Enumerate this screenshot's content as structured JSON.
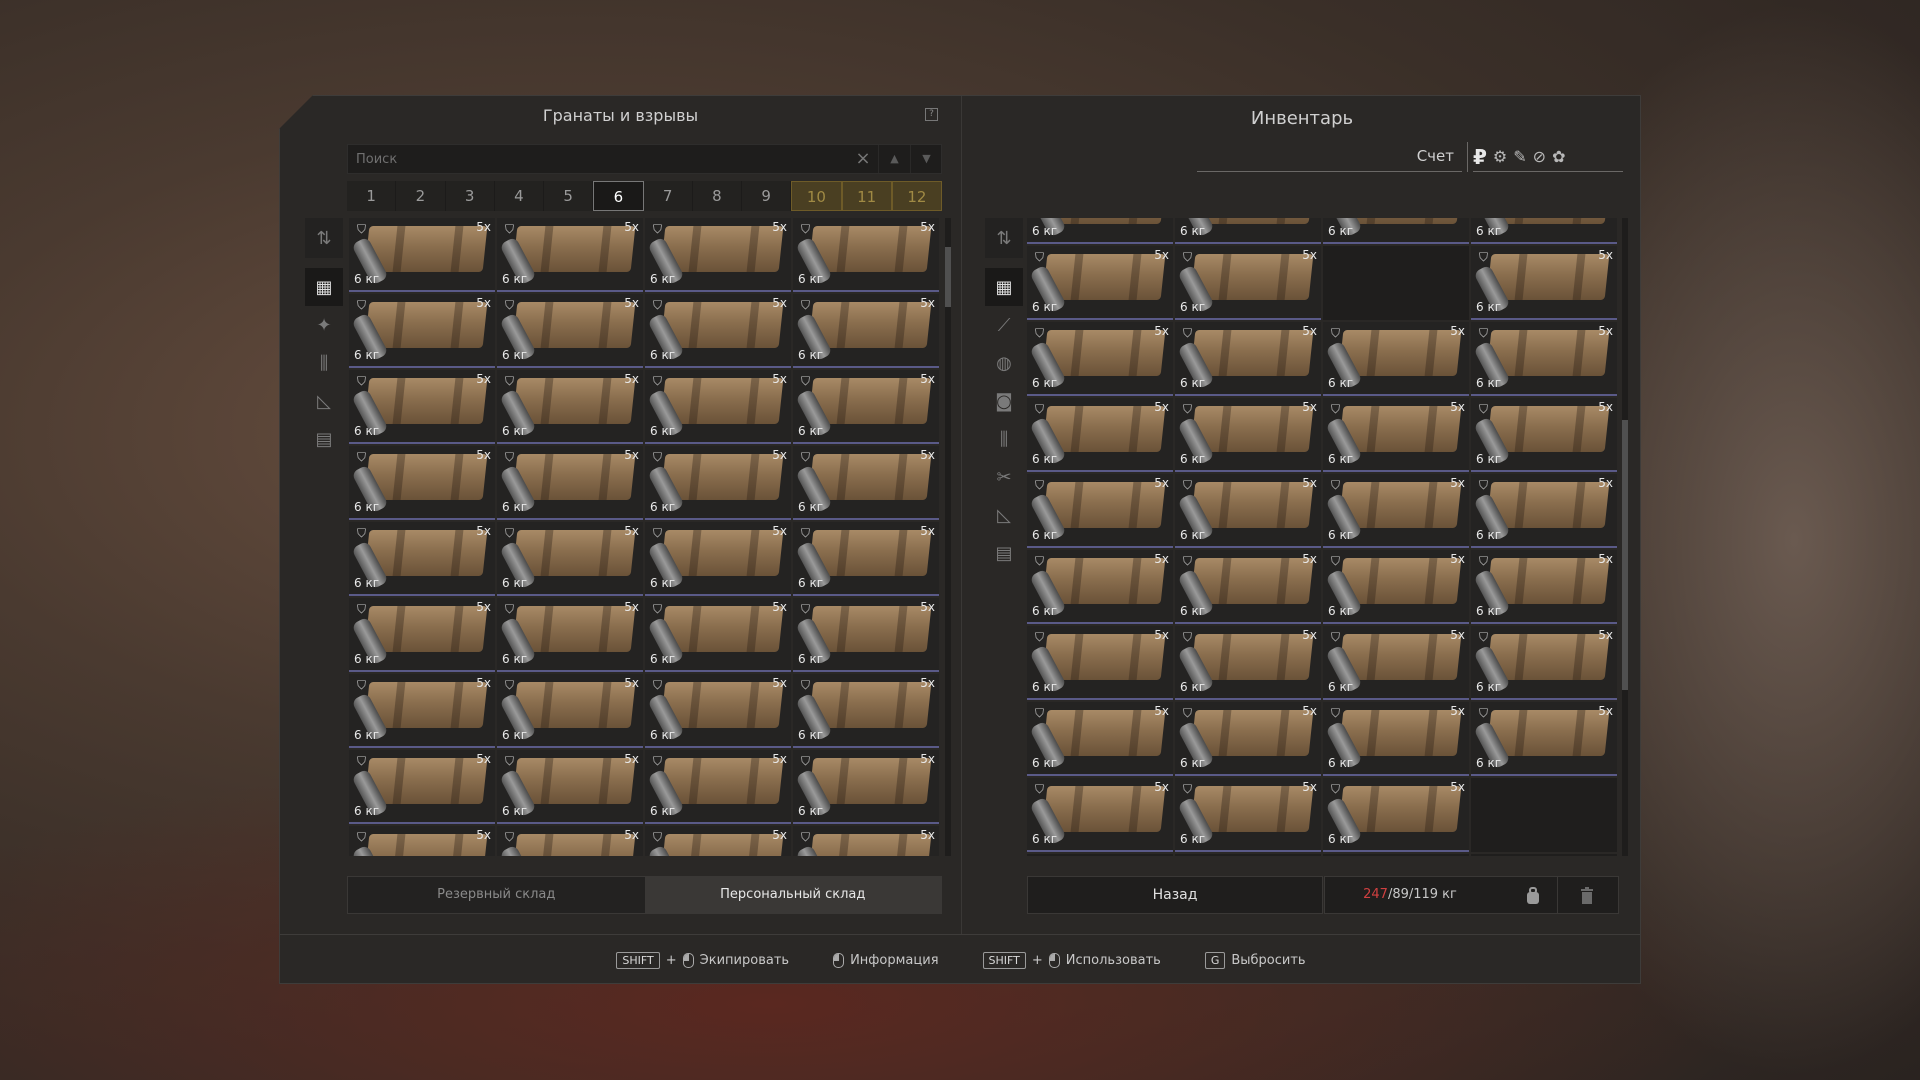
{
  "left": {
    "title": "Гранаты и взрывы",
    "help": "?",
    "search": {
      "placeholder": "Поиск",
      "clear": "×",
      "up": "▲",
      "down": "▼"
    },
    "pages": [
      "1",
      "2",
      "3",
      "4",
      "5",
      "6",
      "7",
      "8",
      "9",
      "10",
      "11",
      "12"
    ],
    "active_page": "6",
    "locked_pages": [
      "10",
      "11",
      "12"
    ],
    "tools": [
      "sort-icon",
      "grid-icon",
      "grenade-icon",
      "ammo-icon",
      "ruler-icon",
      "box-icon"
    ],
    "tabs": [
      {
        "label": "Резервный склад"
      },
      {
        "label": "Персональный склад"
      }
    ],
    "scroll_position": 0.05
  },
  "item": {
    "weight": "6 кг",
    "count": "5x",
    "shield": "⛉"
  },
  "right": {
    "title": "Инвентарь",
    "account_label": "Счет",
    "currencies": [
      "₽",
      "⚙",
      "✎",
      "⊘",
      "✿"
    ],
    "tools": [
      "sort-icon",
      "grid-icon",
      "rifle-icon",
      "globe-icon",
      "camera-icon",
      "ammo-icon",
      "tools-icon",
      "ruler-icon",
      "box-icon"
    ],
    "back": "Назад",
    "weight_over": "247",
    "weight_rest": "/89/119 кг",
    "bag_icon": "bag-icon",
    "trash_icon": "trash-icon",
    "scroll_position": 0.55
  },
  "footer": {
    "hints": [
      {
        "keys": [
          "SHIFT",
          "+"
        ],
        "mouse": true,
        "label": "Экипировать"
      },
      {
        "keys": [],
        "mouse": true,
        "label": "Информация"
      },
      {
        "keys": [
          "SHIFT",
          "+"
        ],
        "mouse": true,
        "label": "Использовать"
      },
      {
        "keys": [
          "G"
        ],
        "mouse": false,
        "label": "Выбросить"
      }
    ]
  },
  "colors": {
    "rarity_stripe": "#5a5a88",
    "over_weight": "#d04040",
    "locked_page": "#a08a44"
  }
}
